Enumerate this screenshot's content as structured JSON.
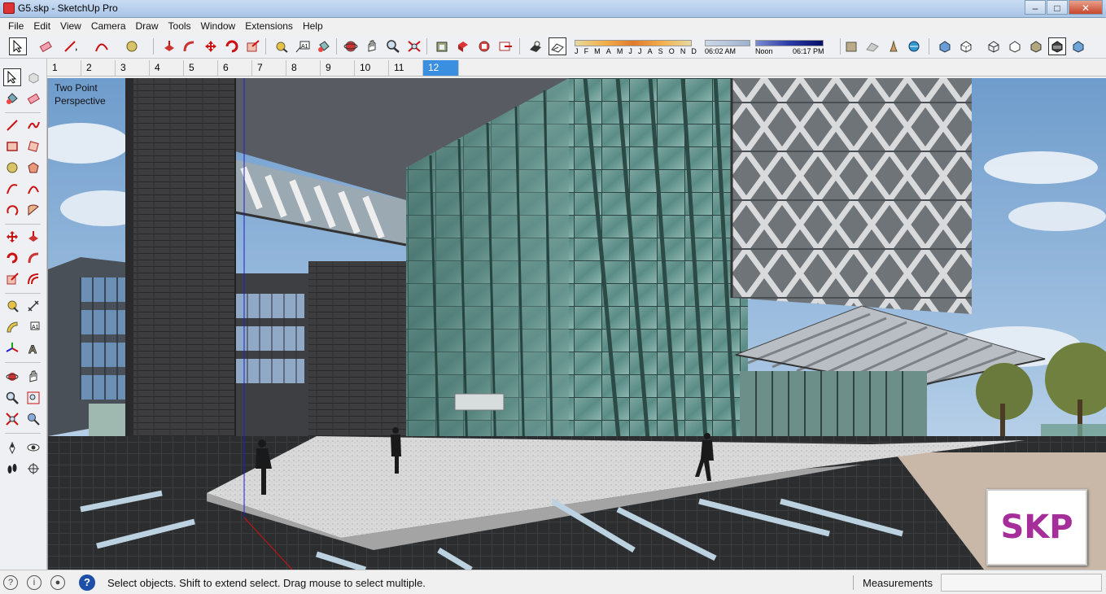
{
  "window": {
    "title": "G5.skp - SketchUp Pro",
    "minimize": "‒",
    "maximize": "□",
    "close": "✕"
  },
  "menu": [
    "File",
    "Edit",
    "View",
    "Camera",
    "Draw",
    "Tools",
    "Window",
    "Extensions",
    "Help"
  ],
  "shadow_settings": {
    "months": [
      "J",
      "F",
      "M",
      "A",
      "M",
      "J",
      "J",
      "A",
      "S",
      "O",
      "N",
      "D"
    ],
    "time_start": "06:02 AM",
    "time_noon": "Noon",
    "time_end": "06:17 PM"
  },
  "scenes": {
    "tabs": [
      "1",
      "2",
      "3",
      "4",
      "5",
      "6",
      "7",
      "8",
      "9",
      "10",
      "11",
      "12"
    ],
    "active": "12"
  },
  "viewport": {
    "camera_label_line1": "Two Point",
    "camera_label_line2": "Perspective",
    "logo_text": "SKP"
  },
  "status": {
    "message": "Select objects. Shift to extend select. Drag mouse to select multiple.",
    "measurements_label": "Measurements",
    "measurements_value": "",
    "help_icon": "?"
  },
  "colors": {
    "accent": "#3a8fe0",
    "logo": "#a62e9b",
    "sky": "#8fb6dc"
  }
}
